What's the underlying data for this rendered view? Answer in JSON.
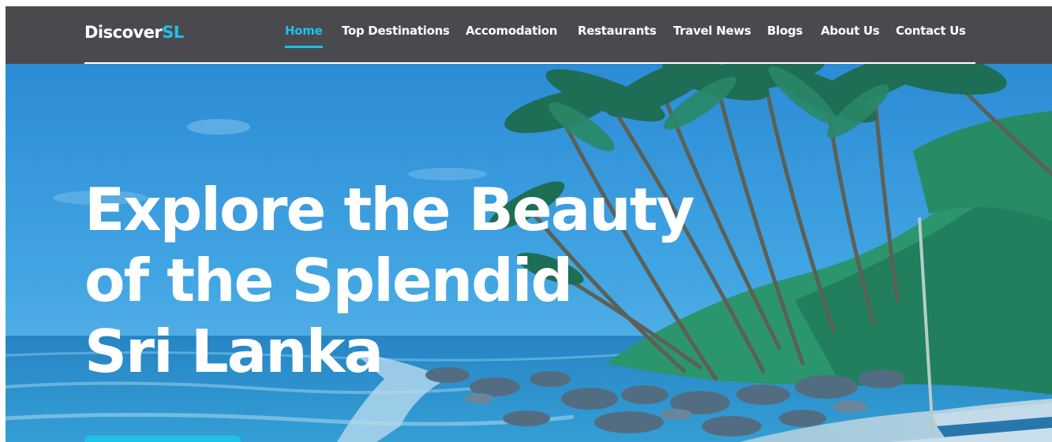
{
  "brand": {
    "name_part1": "Discover",
    "name_part2": "SL",
    "accent_color": "#1fc0ea"
  },
  "nav": {
    "items": [
      {
        "label": "Home",
        "active": true
      },
      {
        "label": "Top Destinations"
      },
      {
        "label": "Accomodation"
      },
      {
        "label": "Restaurants"
      },
      {
        "label": "Travel News"
      },
      {
        "label": "Blogs"
      },
      {
        "label": "About Us"
      },
      {
        "label": "Contact Us"
      }
    ]
  },
  "hero": {
    "headline_lines": [
      "Explore the Beauty",
      "of the Splendid",
      "Sri Lanka"
    ],
    "scene": "tropical-beach-with-palm-trees"
  },
  "colors": {
    "topbar": "#4a4a4e",
    "text": "#ffffff",
    "accent": "#1fc0ea"
  }
}
